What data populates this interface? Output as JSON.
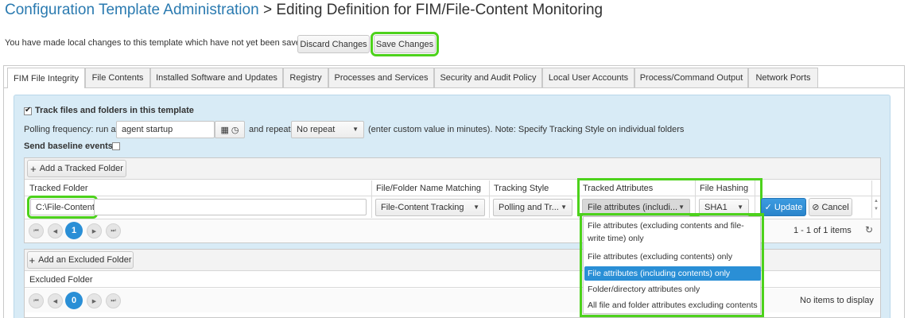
{
  "header": {
    "breadcrumb_link": "Configuration Template Administration",
    "breadcrumb_sep": " > ",
    "breadcrumb_current": "Editing Definition for FIM/File-Content Monitoring"
  },
  "notice": {
    "text": "You have made local changes to this template which have not yet been saved.",
    "discard_label": "Discard Changes",
    "save_label": "Save Changes"
  },
  "tabs": [
    {
      "label": "FIM File Integrity",
      "active": true
    },
    {
      "label": "File Contents"
    },
    {
      "label": "Installed Software and Updates"
    },
    {
      "label": "Registry"
    },
    {
      "label": "Processes and Services"
    },
    {
      "label": "Security and Audit Policy"
    },
    {
      "label": "Local User Accounts"
    },
    {
      "label": "Process/Command Output"
    },
    {
      "label": "Network Ports"
    }
  ],
  "fim": {
    "track_label": "Track files and folders in this template",
    "track_checked": true,
    "polling_label": "Polling frequency: run at",
    "polling_value": "agent startup",
    "repeat_label": "and repeat",
    "repeat_value": "No repeat",
    "hint": "(enter custom value in minutes). Note: Specify Tracking Style on individual folders",
    "baseline_label": "Send baseline events",
    "baseline_checked": false
  },
  "tracked": {
    "add_label": "Add a Tracked Folder",
    "columns": {
      "folder": "Tracked Folder",
      "matching": "File/Folder Name Matching",
      "style": "Tracking Style",
      "attributes": "Tracked Attributes",
      "hashing": "File Hashing"
    },
    "row": {
      "folder": "C:\\File-Content",
      "matching": "File-Content Tracking",
      "style": "Polling and Tr...",
      "attributes": "File attributes (includi...",
      "hashing": "SHA1",
      "update_label": "Update",
      "cancel_label": "Cancel"
    },
    "pager": {
      "current": "1",
      "info": "1 - 1 of 1 items"
    }
  },
  "excluded": {
    "add_label": "Add an Excluded Folder",
    "column": "Excluded Folder",
    "pager": {
      "current": "0",
      "info": "No items to display"
    }
  },
  "attributes_menu": {
    "options": [
      "File attributes (excluding contents and file-write time) only",
      "File attributes (excluding contents) only",
      "File attributes (including contents) only",
      "Folder/directory attributes only",
      "All file and folder attributes excluding contents"
    ],
    "selected_index": 2
  },
  "colors": {
    "link": "#2a7ab0",
    "panel": "#d8ebf6",
    "accent": "#2a8fd6",
    "highlight": "#4dd21c"
  }
}
